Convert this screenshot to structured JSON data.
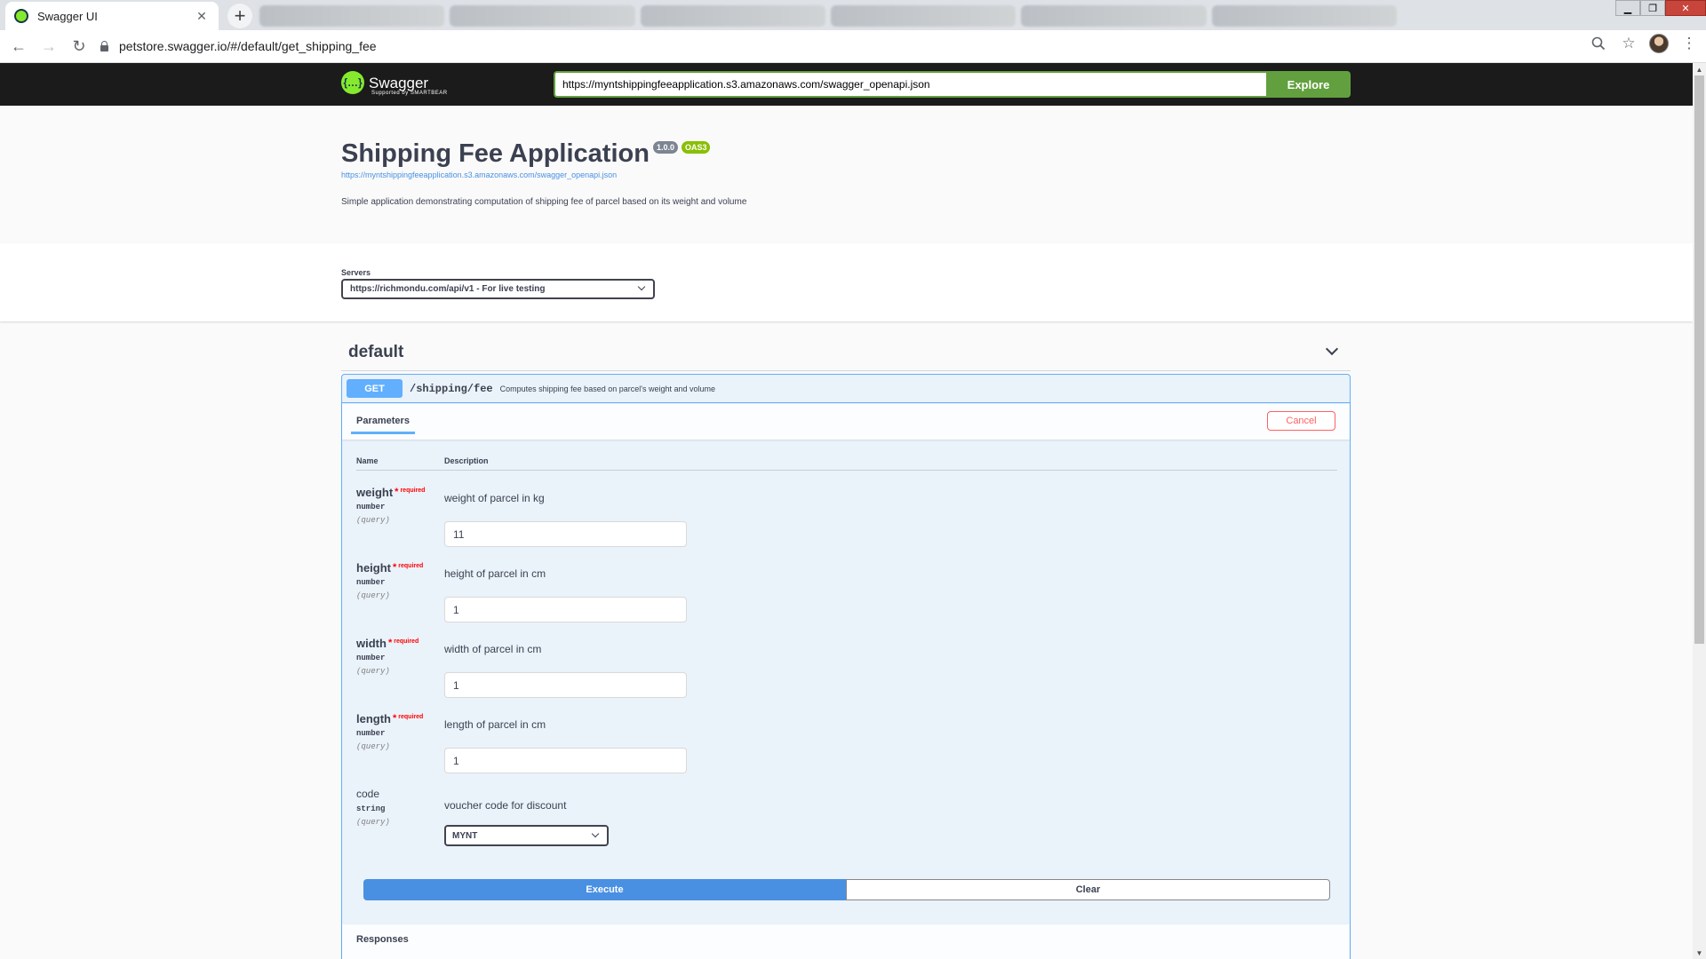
{
  "browser": {
    "tab_title": "Swagger UI",
    "url": "petstore.swagger.io/#/default/get_shipping_fee"
  },
  "swagger": {
    "logo_text": "Swagger",
    "logo_sub": "Supported by SMARTBEAR",
    "spec_url_input": "https://myntshippingfeeapplication.s3.amazonaws.com/swagger_openapi.json",
    "explore_label": "Explore"
  },
  "info": {
    "title": "Shipping Fee Application",
    "version": "1.0.0",
    "oas": "OAS3",
    "spec_link": "https://myntshippingfeeapplication.s3.amazonaws.com/swagger_openapi.json",
    "description": "Simple application demonstrating computation of shipping fee of parcel based on its weight and volume"
  },
  "servers": {
    "label": "Servers",
    "selected": "https://richmondu.com/api/v1 - For live testing"
  },
  "tag": {
    "name": "default"
  },
  "operation": {
    "method": "GET",
    "path": "/shipping/fee",
    "summary": "Computes shipping fee based on parcel's weight and volume",
    "tab_label": "Parameters",
    "cancel_label": "Cancel",
    "col_name": "Name",
    "col_description": "Description",
    "required_label": "required",
    "required_star": "*",
    "params": [
      {
        "name": "weight",
        "type": "number",
        "in": "(query)",
        "description": "weight of parcel in kg",
        "value": "11"
      },
      {
        "name": "height",
        "type": "number",
        "in": "(query)",
        "description": "height of parcel in cm",
        "value": "1"
      },
      {
        "name": "width",
        "type": "number",
        "in": "(query)",
        "description": "width of parcel in cm",
        "value": "1"
      },
      {
        "name": "length",
        "type": "number",
        "in": "(query)",
        "description": "length of parcel in cm",
        "value": "1"
      },
      {
        "name": "code",
        "type": "string",
        "in": "(query)",
        "description": "voucher code for discount",
        "value": "MYNT"
      }
    ],
    "execute_label": "Execute",
    "clear_label": "Clear",
    "responses_label": "Responses"
  }
}
